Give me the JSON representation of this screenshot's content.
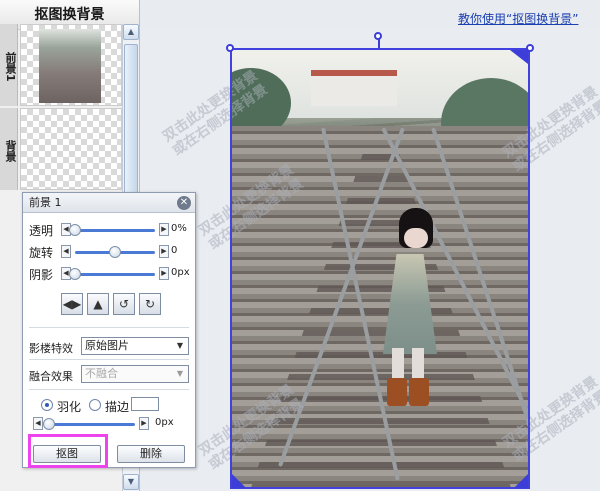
{
  "sidebar": {
    "title": "抠图换背景",
    "layers": [
      {
        "tab_label": "前景1"
      },
      {
        "tab_label": "背景"
      }
    ]
  },
  "help_link": "教你使用“抠图换背景”",
  "panel": {
    "title": "前景 1",
    "close_icon": "close-icon",
    "sliders": [
      {
        "label": "透明",
        "value": "0%",
        "level_percent": 0
      },
      {
        "label": "旋转",
        "value": "0",
        "level_percent": 50
      },
      {
        "label": "阴影",
        "value": "0px",
        "level_percent": 0
      }
    ],
    "tools": [
      "flip-horizontal-icon",
      "flip-vertical-icon",
      "rotate-left-icon",
      "rotate-right-icon"
    ],
    "effect": {
      "label": "影楼特效",
      "value": "原始图片"
    },
    "blend": {
      "label": "融合效果",
      "value": "不融合"
    },
    "feather": {
      "label": "羽化",
      "selected": true
    },
    "stroke": {
      "label": "描边",
      "selected": false
    },
    "edge_value": "0px",
    "edge_level_percent": 0,
    "cutout_button": "抠图",
    "delete_button": "删除"
  },
  "watermark": [
    {
      "line1": "双击此处更换背景",
      "line2": "或在右侧选择背景"
    }
  ],
  "colors": {
    "selection": "#4141e0",
    "highlight": "#ee44ee",
    "link": "#1a3fb0"
  }
}
